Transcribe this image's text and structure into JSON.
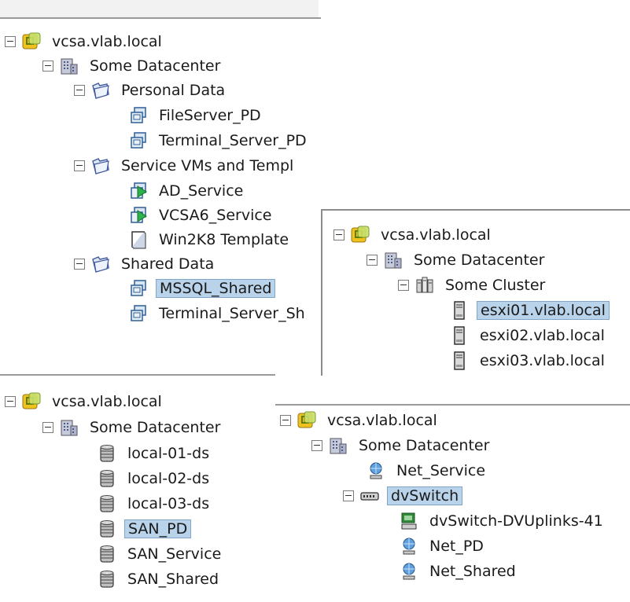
{
  "vm_panel": {
    "rows": [
      {
        "label": "vcsa.vlab.local"
      },
      {
        "label": "Some Datacenter"
      },
      {
        "label": "Personal Data"
      },
      {
        "label": "FileServer_PD"
      },
      {
        "label": "Terminal_Server_PD"
      },
      {
        "label": "Service VMs and Templ"
      },
      {
        "label": "AD_Service"
      },
      {
        "label": "VCSA6_Service"
      },
      {
        "label": "Win2K8 Template"
      },
      {
        "label": "Shared Data"
      },
      {
        "label": "MSSQL_Shared",
        "selected": true
      },
      {
        "label": "Terminal_Server_Sh"
      }
    ]
  },
  "host_panel": {
    "rows": [
      {
        "label": "vcsa.vlab.local"
      },
      {
        "label": "Some Datacenter"
      },
      {
        "label": "Some Cluster"
      },
      {
        "label": "esxi01.vlab.local",
        "selected": true
      },
      {
        "label": "esxi02.vlab.local"
      },
      {
        "label": "esxi03.vlab.local"
      }
    ]
  },
  "storage_panel": {
    "rows": [
      {
        "label": "vcsa.vlab.local"
      },
      {
        "label": "Some Datacenter"
      },
      {
        "label": "local-01-ds"
      },
      {
        "label": "local-02-ds"
      },
      {
        "label": "local-03-ds"
      },
      {
        "label": "SAN_PD",
        "selected": true
      },
      {
        "label": "SAN_Service"
      },
      {
        "label": "SAN_Shared"
      }
    ]
  },
  "network_panel": {
    "rows": [
      {
        "label": "vcsa.vlab.local"
      },
      {
        "label": "Some Datacenter"
      },
      {
        "label": "Net_Service"
      },
      {
        "label": "dvSwitch",
        "selected": true
      },
      {
        "label": "dvSwitch-DVUplinks-41"
      },
      {
        "label": "Net_PD"
      },
      {
        "label": "Net_Shared"
      }
    ]
  },
  "colors": {
    "selection_bg": "#b9d3ea",
    "vcenter_icon": "#e8b21a",
    "folder": "#d7dfef"
  }
}
